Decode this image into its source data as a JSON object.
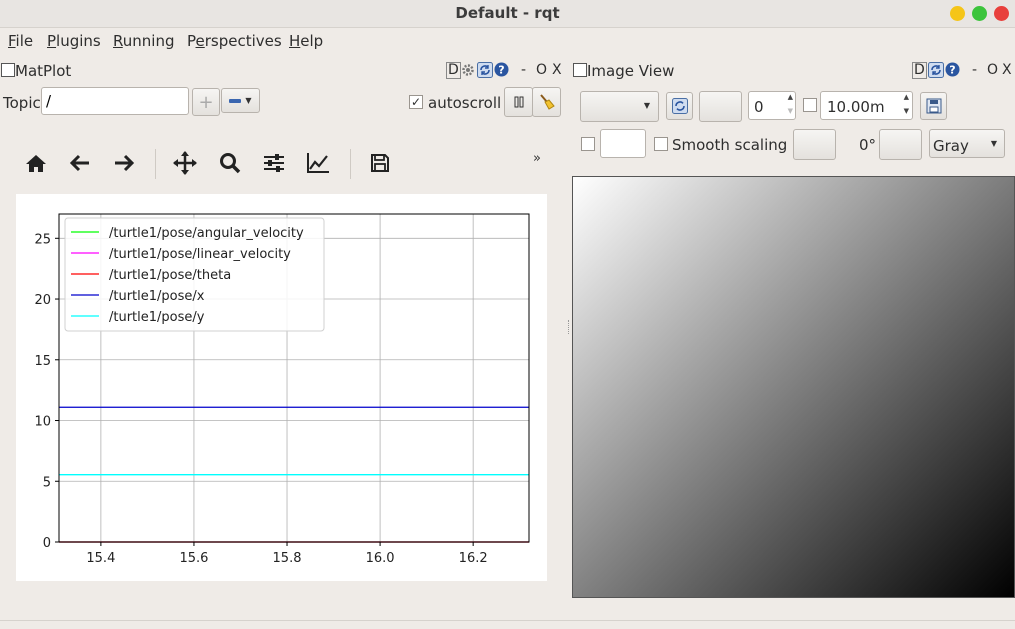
{
  "window": {
    "title": "Default - rqt"
  },
  "menu": [
    {
      "pre": "",
      "u": "F",
      "post": "ile"
    },
    {
      "pre": "",
      "u": "P",
      "post": "lugins"
    },
    {
      "pre": "",
      "u": "R",
      "post": "unning"
    },
    {
      "pre": "P",
      "u": "e",
      "post": "rspectives"
    },
    {
      "pre": "",
      "u": "H",
      "post": "elp"
    }
  ],
  "matplot": {
    "title": "MatPlot",
    "dock_d": "D",
    "dock_dash": "-",
    "dock_o": "O",
    "dock_x": "X",
    "topic_label": "Topic",
    "topic_value": "/",
    "add_glyph": "+",
    "remove_glyph": "−",
    "autoscroll_label": "autoscroll",
    "autoscroll_checked": true,
    "more_glyph": "»"
  },
  "imageview": {
    "title": "Image View",
    "dock_d": "D",
    "dock_dash": "-",
    "dock_o": "O",
    "dock_x": "X",
    "spin_value": "0",
    "duration_value": "10.00m",
    "smooth_label": "Smooth scaling",
    "rotation_label": "0°",
    "colormap_value": "Gray"
  },
  "chart_data": {
    "type": "line",
    "xlim": [
      15.31,
      16.32
    ],
    "ylim": [
      0,
      27
    ],
    "xticks": [
      15.4,
      15.6,
      15.8,
      16.0,
      16.2
    ],
    "xtick_labels": [
      "15.4",
      "15.6",
      "15.8",
      "16.0",
      "16.2"
    ],
    "yticks": [
      0,
      5,
      10,
      15,
      20,
      25
    ],
    "ytick_labels": [
      "0",
      "5",
      "10",
      "15",
      "20",
      "25"
    ],
    "grid": true,
    "legend": "top-left",
    "series": [
      {
        "name": "/turtle1/pose/angular_velocity",
        "color": "#00ff00",
        "x": [
          15.31,
          16.32
        ],
        "y": [
          0,
          0
        ]
      },
      {
        "name": "/turtle1/pose/linear_velocity",
        "color": "#ff00ff",
        "x": [
          15.31,
          16.32
        ],
        "y": [
          0,
          0
        ]
      },
      {
        "name": "/turtle1/pose/theta",
        "color": "#ff0000",
        "x": [
          15.31,
          16.32
        ],
        "y": [
          0,
          0
        ]
      },
      {
        "name": "/turtle1/pose/x",
        "color": "#0000cc",
        "x": [
          15.31,
          16.32
        ],
        "y": [
          11.09,
          11.09
        ]
      },
      {
        "name": "/turtle1/pose/y",
        "color": "#00ffff",
        "x": [
          15.31,
          16.32
        ],
        "y": [
          5.54,
          5.54
        ]
      }
    ]
  }
}
